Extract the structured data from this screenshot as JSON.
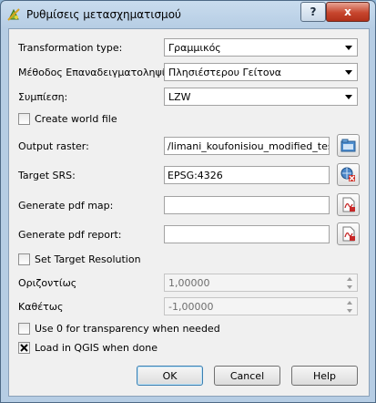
{
  "window": {
    "title": "Ρυθμίσεις μετασχηματισμού",
    "help_button_label": "?",
    "close_button_label": "x",
    "app_icon": "qgis-georeferencer-icon"
  },
  "form": {
    "transformation_type": {
      "label": "Transformation type:",
      "value": "Γραμμικός"
    },
    "resampling_method": {
      "label": "Μέθοδος Επαναδειγματοληψίας:",
      "value": "Πλησιέστερου Γείτονα"
    },
    "compression": {
      "label": "Συμπίεση:",
      "value": "LZW"
    },
    "create_world_file": {
      "label": "Create world file",
      "checked": false
    },
    "output_raster": {
      "label": "Output raster:",
      "value": "/limani_koufonisiou_modified_test.tif",
      "button_icon": "folder-open-icon"
    },
    "target_srs": {
      "label": "Target SRS:",
      "value": "EPSG:4326",
      "button_icon": "projection-globe-icon"
    },
    "pdf_map": {
      "label": "Generate pdf map:",
      "value": "",
      "button_icon": "pdf-file-icon"
    },
    "pdf_report": {
      "label": "Generate pdf report:",
      "value": "",
      "button_icon": "pdf-file-icon"
    },
    "set_target_resolution": {
      "label": "Set Target Resolution",
      "checked": false
    },
    "horizontal": {
      "label": "Οριζοντίως",
      "value": "1,00000"
    },
    "vertical": {
      "label": "Καθέτως",
      "value": "-1,00000"
    },
    "use_zero_transparency": {
      "label": "Use 0 for transparency when needed",
      "checked": false
    },
    "load_in_qgis": {
      "label": "Load in QGIS when done",
      "checked": true
    }
  },
  "buttons": {
    "ok": "OK",
    "cancel": "Cancel",
    "help": "Help"
  }
}
